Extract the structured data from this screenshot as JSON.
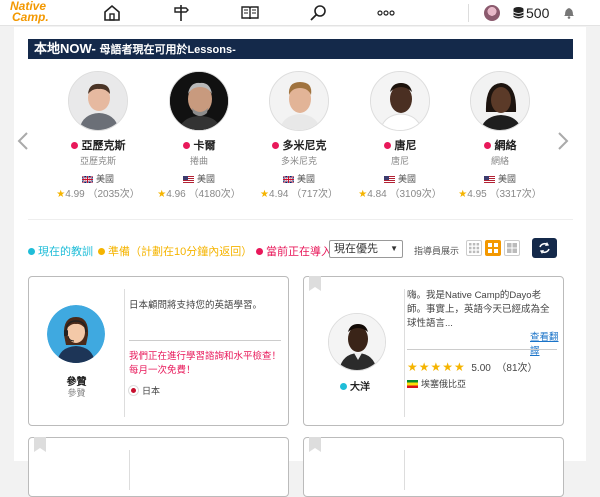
{
  "header": {
    "logo_line1": "Native",
    "logo_line2": "Camp.",
    "points": "500"
  },
  "section": {
    "title": "本地NOW-",
    "subtitle": "母語者現在可用於Lessons-"
  },
  "teachers": [
    {
      "name": "亞歷克斯",
      "sub": "亞歷克斯",
      "country": "美國",
      "flag": "uk",
      "rating": "4.99",
      "count": "（2035次）"
    },
    {
      "name": "卡爾",
      "sub": "捲曲",
      "country": "美國",
      "flag": "us",
      "rating": "4.96",
      "count": "（4180次）"
    },
    {
      "name": "多米尼克",
      "sub": "多米尼克",
      "country": "美國",
      "flag": "uk",
      "rating": "4.94",
      "count": "（717次）"
    },
    {
      "name": "唐尼",
      "sub": "唐尼",
      "country": "美國",
      "flag": "us",
      "rating": "4.84",
      "count": "（3109次）"
    },
    {
      "name": "網絡",
      "sub": "網絡",
      "country": "美國",
      "flag": "us",
      "rating": "4.95",
      "count": "（3317次）"
    }
  ],
  "legend": {
    "now": "現在的教訓",
    "ready": "準備（計劃在10分鐘內返回）",
    "importing": "當前正在導入"
  },
  "colors": {
    "now": "#1fbdd8",
    "ready": "#f5b400",
    "importing": "#e8185a",
    "navy": "#14294a",
    "accent": "#f39800"
  },
  "sort": {
    "selected": "現在優先"
  },
  "display_label": "指導員展示",
  "card1": {
    "name": "參贊",
    "sub": "參贊",
    "text": "日本顧問將支持您的英語學習。",
    "red": "我們正在進行學習諮詢和水平檢查！每月一次免費！",
    "country": "日本"
  },
  "card2": {
    "name": "大洋",
    "text": "嗨。我是Native Camp的Dayo老師。事實上，英語今天已經成為全球性語言...",
    "link": "查看翻譯",
    "rating": "5.00",
    "count": "（81次）",
    "country": "埃塞俄比亞"
  }
}
